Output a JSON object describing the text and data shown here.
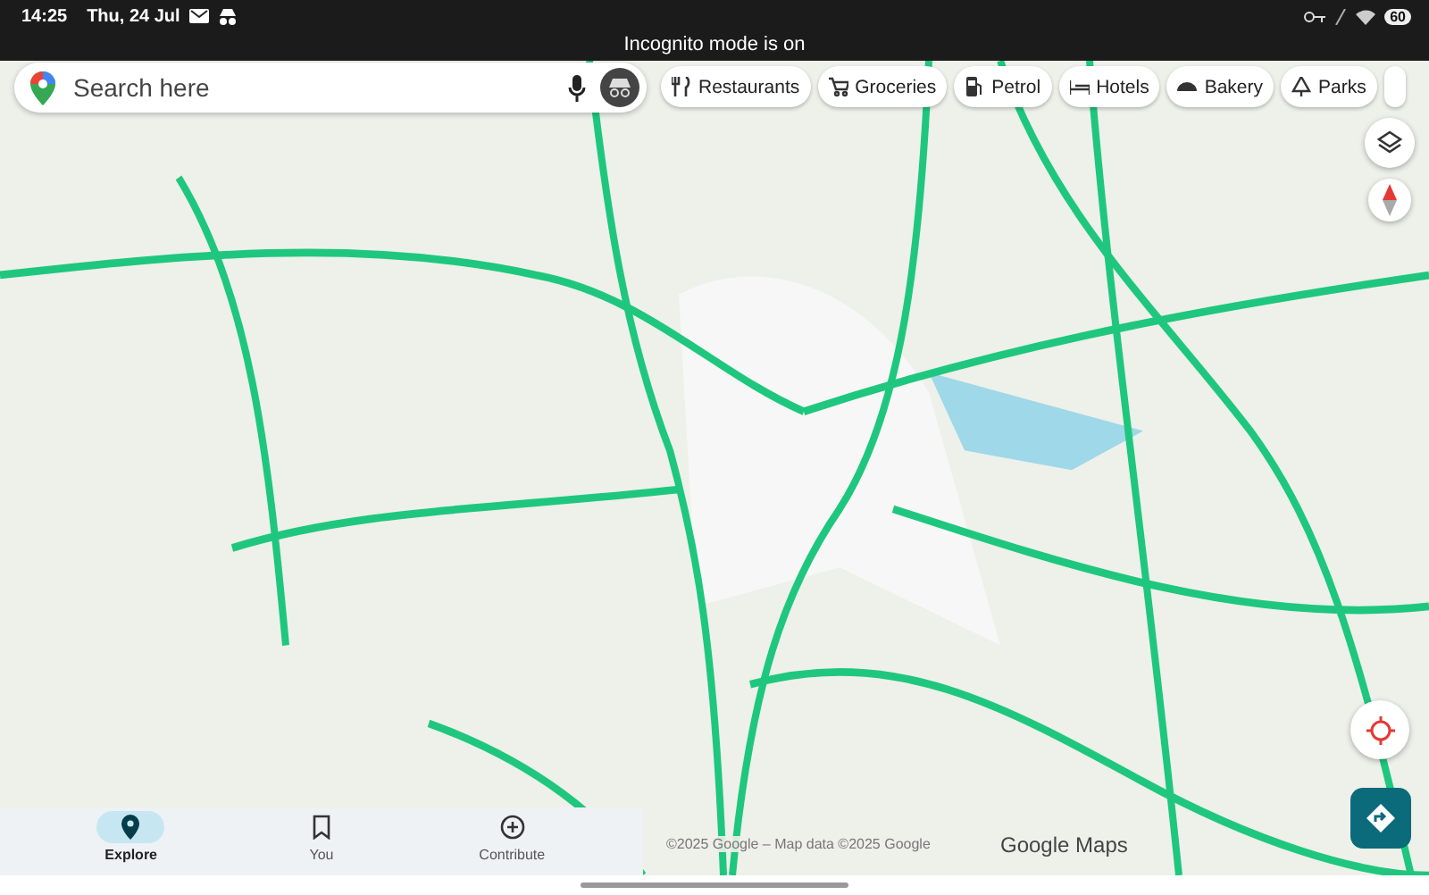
{
  "status_bar": {
    "time": "14:25",
    "date": "Thu, 24 Jul",
    "battery": "60"
  },
  "incognito_banner": "Incognito mode is on",
  "search": {
    "placeholder": "Search here"
  },
  "chips": [
    {
      "label": "Restaurants",
      "kind": "restaurant"
    },
    {
      "label": "Groceries",
      "kind": "cart"
    },
    {
      "label": "Petrol",
      "kind": "fuel"
    },
    {
      "label": "Hotels",
      "kind": "bed"
    },
    {
      "label": "Bakery",
      "kind": "bakery"
    },
    {
      "label": "Parks",
      "kind": "tree"
    }
  ],
  "attribution": "©2025 Google – Map data ©2025 Google",
  "map_logo": "Google Maps",
  "bottom_nav": [
    {
      "label": "Explore",
      "kind": "pin",
      "selected": true
    },
    {
      "label": "You",
      "kind": "bookmark",
      "selected": false
    },
    {
      "label": "Contribute",
      "kind": "plus",
      "selected": false
    }
  ]
}
